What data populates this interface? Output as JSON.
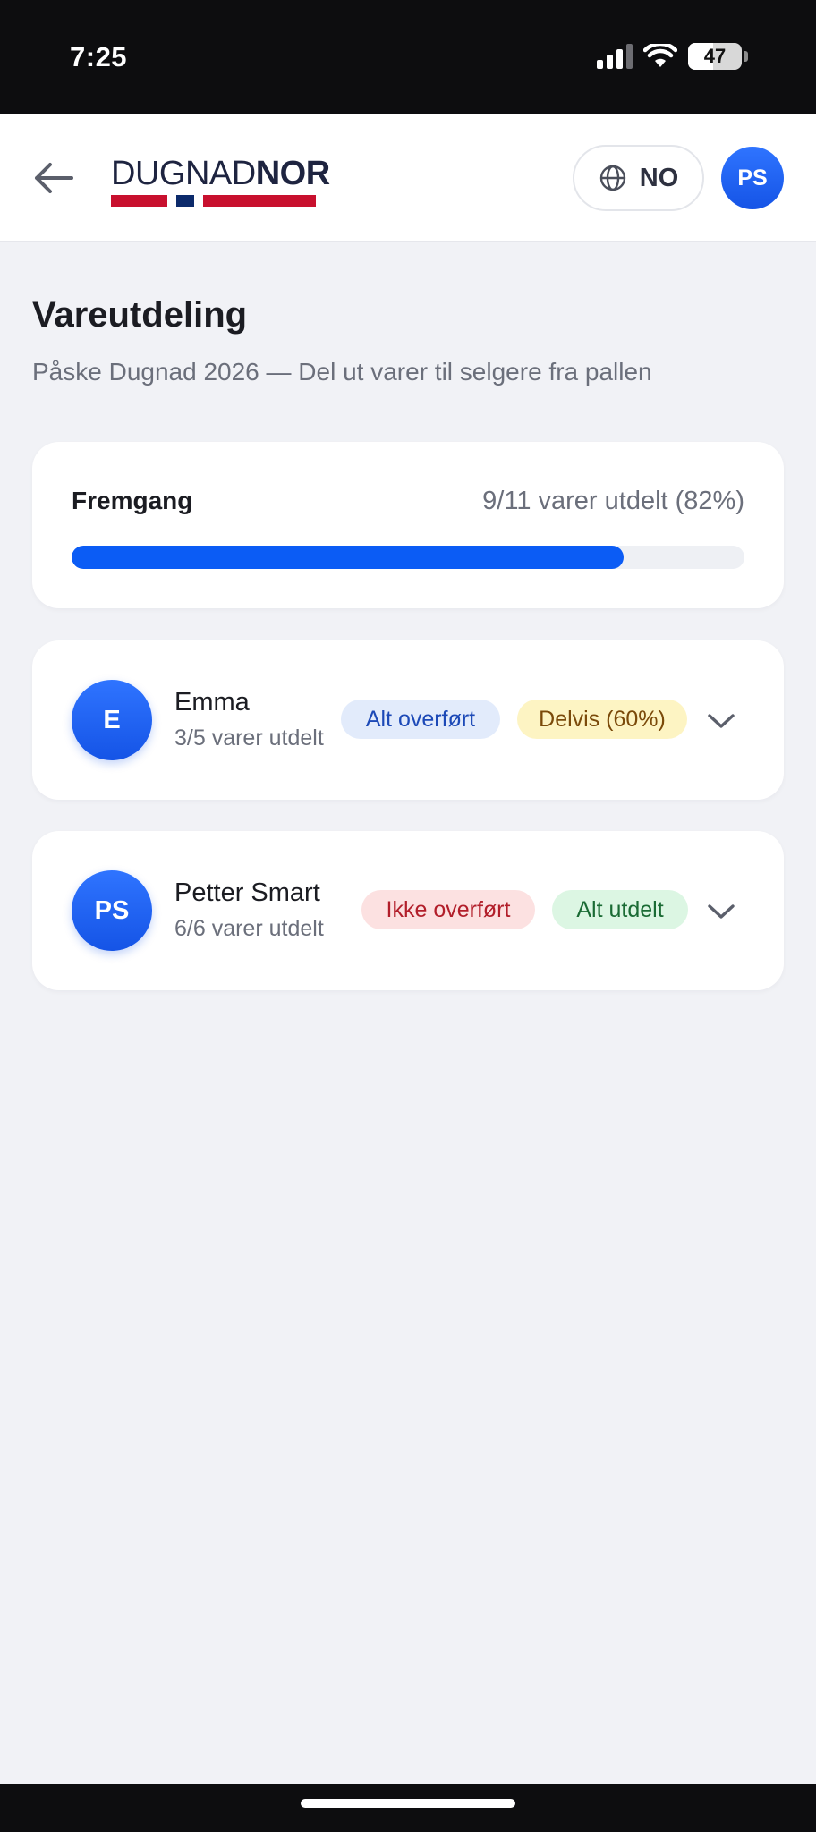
{
  "status_bar": {
    "time": "7:25",
    "battery_percent": 47,
    "battery_label": "47",
    "icons": [
      "cellular-signal-icon",
      "wifi-icon",
      "battery-icon"
    ]
  },
  "header": {
    "back_icon": "arrow-left-icon",
    "logo": {
      "light": "DUGNAD",
      "bold": "NOR"
    },
    "language": {
      "icon": "globe-icon",
      "label": "NO"
    },
    "avatar_initials": "PS"
  },
  "page": {
    "title": "Vareutdeling",
    "subtitle": "Påske Dugnad 2026 — Del ut varer til selgere fra pallen"
  },
  "progress": {
    "label": "Fremgang",
    "value_text": "9/11 varer utdelt (82%)",
    "fraction": 0.82
  },
  "sellers": [
    {
      "initials": "E",
      "name": "Emma",
      "progress_text": "3/5 varer utdelt",
      "transfer_badge": "Alt overført",
      "distribution_badge": "Delvis (60%)"
    },
    {
      "initials": "PS",
      "name": "Petter Smart",
      "progress_text": "6/6 varer utdelt",
      "transfer_badge": "Ikke overført",
      "distribution_badge": "Alt utdelt"
    }
  ],
  "colors": {
    "accent": "#0b5cf5",
    "badge_blue": "#e2ebfb",
    "badge_yellow": "#fdf4c3",
    "badge_red": "#fce1e1",
    "badge_green": "#dcf6e3",
    "flag_red": "#c8102e",
    "flag_blue": "#0c2a6b"
  }
}
